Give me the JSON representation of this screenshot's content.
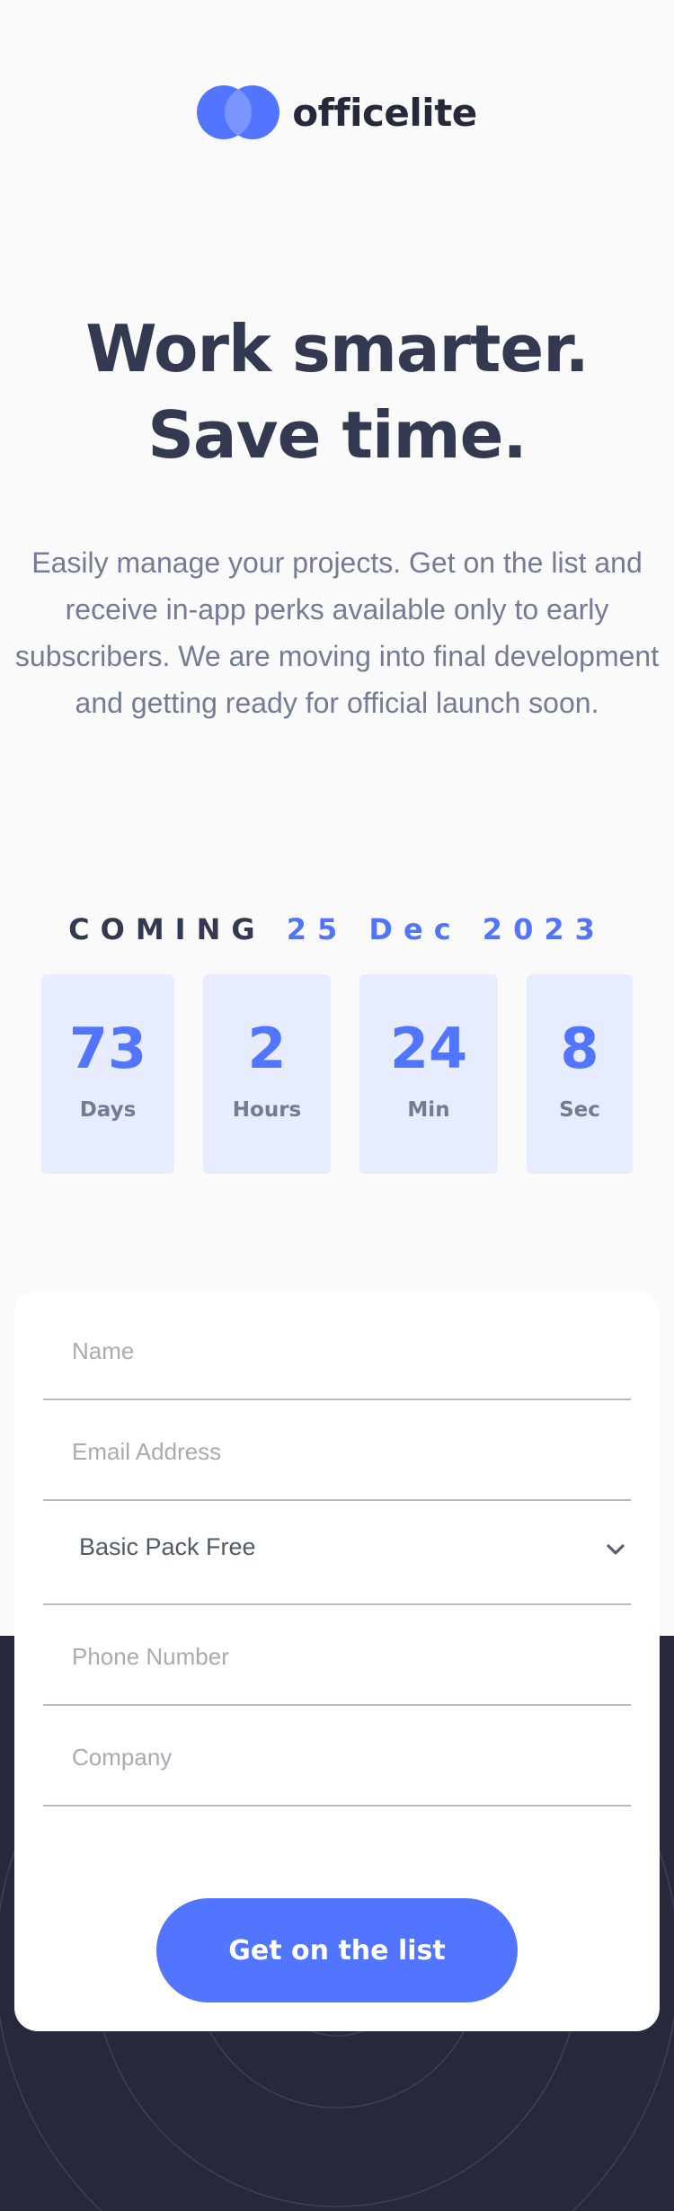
{
  "brand": {
    "name": "officelite",
    "logo_icon": "two-overlapping-circles-icon",
    "colors": {
      "primary": "#5175ff",
      "dark": "#25293a",
      "text": "#333950",
      "muted": "#747b95"
    }
  },
  "hero": {
    "title": "Work smarter. Save time.",
    "description": "Easily manage your projects. Get on the list and receive in-app perks available only to early subscribers. We are moving into final development and getting ready for official launch soon."
  },
  "countdown": {
    "prefix": "COMING",
    "date": "25 Dec 2023",
    "units": [
      {
        "value": "73",
        "label": "Days"
      },
      {
        "value": "2",
        "label": "Hours"
      },
      {
        "value": "24",
        "label": "Min"
      },
      {
        "value": "8",
        "label": "Sec"
      }
    ]
  },
  "form": {
    "name_placeholder": "Name",
    "email_placeholder": "Email Address",
    "plan_selected": "Basic Pack Free",
    "phone_placeholder": "Phone Number",
    "company_placeholder": "Company",
    "submit_label": "Get on the list"
  }
}
